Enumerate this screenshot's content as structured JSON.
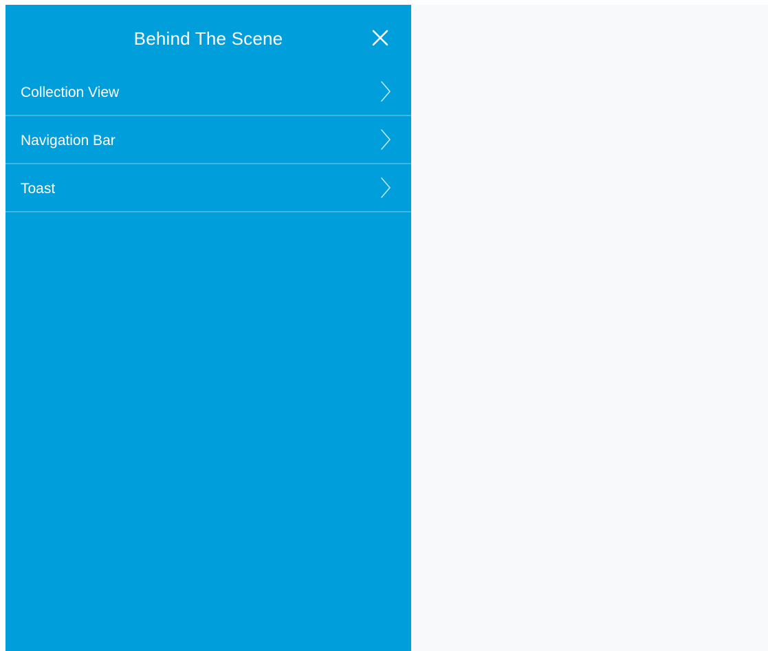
{
  "drawer": {
    "title": "Behind The Scene",
    "close_icon": "close-icon",
    "items": [
      {
        "label": "Collection View",
        "icon": "chevron-right-icon"
      },
      {
        "label": "Navigation Bar",
        "icon": "chevron-right-icon"
      },
      {
        "label": "Toast",
        "icon": "chevron-right-icon"
      }
    ]
  },
  "colors": {
    "drawer_background": "#009fdc",
    "divider": "#3fb6e4",
    "content_background": "#f8f9fa",
    "text": "#ffffff"
  }
}
